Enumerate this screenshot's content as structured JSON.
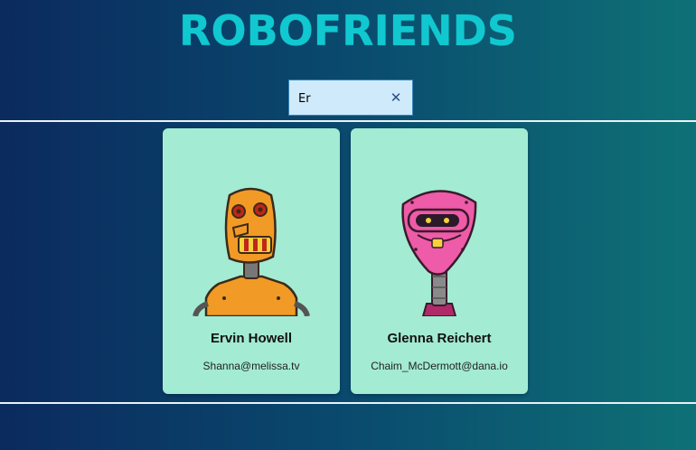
{
  "app": {
    "title": "ROBOFRIENDS"
  },
  "search": {
    "value": "Er",
    "clear_icon": "close-icon"
  },
  "cards": [
    {
      "name": "Ervin Howell",
      "email": "Shanna@melissa.tv",
      "robot": "orange-robot-avatar"
    },
    {
      "name": "Glenna Reichert",
      "email": "Chaim_McDermott@dana.io",
      "robot": "pink-robot-avatar"
    }
  ],
  "colors": {
    "title": "#11c8d0",
    "card": "#a3ebd3",
    "search_bg": "#cfeafb",
    "background_start": "#0b2a5e",
    "background_end": "#0e7176"
  }
}
